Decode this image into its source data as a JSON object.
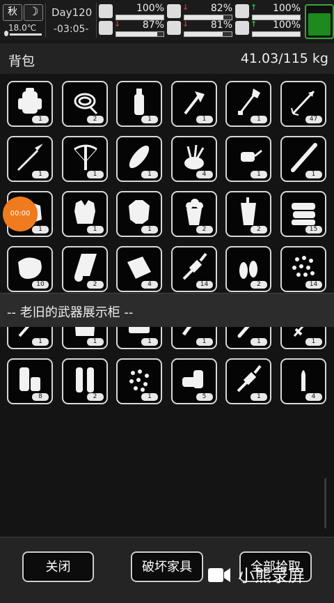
{
  "status": {
    "season": "秋",
    "temperature": "18.0℃",
    "day": "Day120",
    "time": "-03:05-",
    "stats": [
      {
        "name": "health",
        "icon": "medkit-icon",
        "percent": "100%",
        "level": 1.0,
        "arrow": "",
        "arrow_color": ""
      },
      {
        "name": "hunger",
        "icon": "stomach-icon",
        "percent": "82%",
        "level": 0.82,
        "arrow": "↓",
        "arrow_color": "#e03030"
      },
      {
        "name": "energy",
        "icon": "battery-level-icon",
        "percent": "100%",
        "level": 1.0,
        "arrow": "↑",
        "arrow_color": "#30c030"
      },
      {
        "name": "stamina",
        "icon": "boot-icon",
        "percent": "87%",
        "level": 0.87,
        "arrow": "↓",
        "arrow_color": "#e03030"
      },
      {
        "name": "thirst",
        "icon": "water-drop-icon",
        "percent": "81%",
        "level": 0.81,
        "arrow": "↓",
        "arrow_color": "#e03030"
      },
      {
        "name": "mood",
        "icon": "heart-icon",
        "percent": "100%",
        "level": 1.0,
        "arrow": "↑",
        "arrow_color": "#30c030"
      }
    ],
    "battery_level": 0.7
  },
  "inventory": {
    "title": "背包",
    "weight": "41.03/115 kg",
    "items": [
      {
        "icon": "backpack-icon",
        "qty": "1"
      },
      {
        "icon": "rope-icon",
        "qty": "2"
      },
      {
        "icon": "water-bottle-icon",
        "qty": "1"
      },
      {
        "icon": "hatchet-icon",
        "qty": "1"
      },
      {
        "icon": "shovel-icon",
        "qty": "1"
      },
      {
        "icon": "arrow-icon",
        "qty": "47"
      },
      {
        "icon": "spear-icon",
        "qty": "1"
      },
      {
        "icon": "crossbow-icon",
        "qty": "1"
      },
      {
        "icon": "bread-icon",
        "qty": "1"
      },
      {
        "icon": "herbs-icon",
        "qty": "4"
      },
      {
        "icon": "car-key-icon",
        "qty": "1"
      },
      {
        "icon": "baseball-bat-icon",
        "qty": "1"
      },
      {
        "icon": "fur-icon",
        "qty": "1"
      },
      {
        "icon": "armor-vest-icon",
        "qty": "1"
      },
      {
        "icon": "leather-jacket-icon",
        "qty": "1"
      },
      {
        "icon": "popcorn-icon",
        "qty": "2"
      },
      {
        "icon": "cola-cup-icon",
        "qty": "2"
      },
      {
        "icon": "cloth-pile-icon",
        "qty": "15"
      },
      {
        "icon": "raw-meat-icon",
        "qty": "10"
      },
      {
        "icon": "paper-roll-icon",
        "qty": "2"
      },
      {
        "icon": "leather-sheet-icon",
        "qty": "4"
      },
      {
        "icon": "spark-plug-icon",
        "qty": "14"
      },
      {
        "icon": "bullets-icon",
        "qty": "2"
      },
      {
        "icon": "pellets-icon",
        "qty": "14"
      }
    ]
  },
  "container": {
    "title": "-- 老旧的武器展示柜 --",
    "items": [
      {
        "icon": "knife-icon",
        "qty": "1"
      },
      {
        "icon": "jacket-icon",
        "qty": "1"
      },
      {
        "icon": "radio-icon",
        "qty": "1"
      },
      {
        "icon": "machete-icon",
        "qty": "1"
      },
      {
        "icon": "bat-icon",
        "qty": "1"
      },
      {
        "icon": "sword-icon",
        "qty": "1"
      },
      {
        "icon": "battery-cells-icon",
        "qty": "8"
      },
      {
        "icon": "ammo-shells-icon",
        "qty": "2"
      },
      {
        "icon": "shot-pellets-icon",
        "qty": "1"
      },
      {
        "icon": "shotgun-shells-icon",
        "qty": "5"
      },
      {
        "icon": "spark-plug-icon",
        "qty": "1"
      },
      {
        "icon": "bullet-icon",
        "qty": "4"
      }
    ]
  },
  "buttons": {
    "close": "关闭",
    "destroy": "破坏家具",
    "take_all": "全部拾取"
  },
  "overlay": {
    "record_timer": "00:00",
    "watermark": "小熊录屏"
  }
}
